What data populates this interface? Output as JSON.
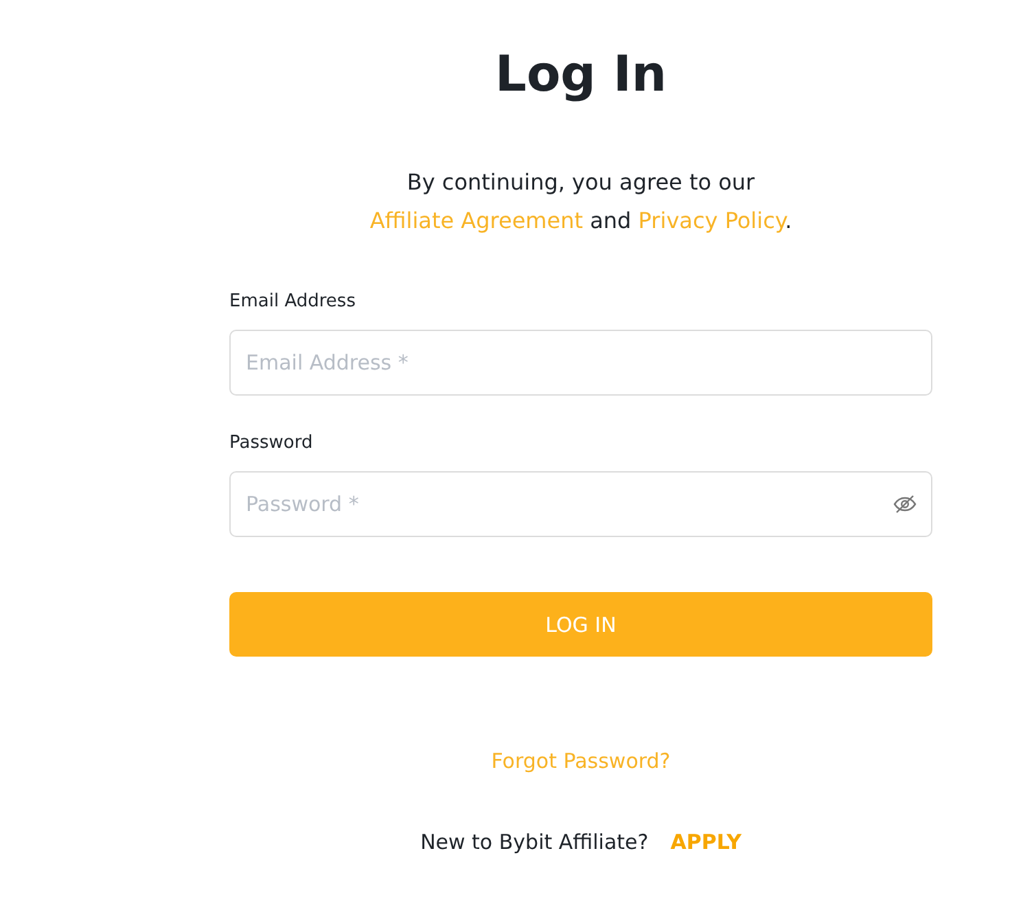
{
  "title": "Log In",
  "agreement": {
    "intro": "By continuing, you agree to our",
    "links": [
      "Affiliate Agreement",
      "Privacy Policy"
    ],
    "joiner": "and",
    "end": "."
  },
  "fields": [
    {
      "label": "Email Address",
      "placeholder": "Email Address *",
      "kind": "text"
    },
    {
      "label": "Password",
      "placeholder": "Password *",
      "kind": "password"
    }
  ],
  "submit": "LOG IN",
  "forgot": "Forgot Password?",
  "signup": {
    "prompt": "New to Bybit Affiliate?",
    "action": "APPLY"
  }
}
